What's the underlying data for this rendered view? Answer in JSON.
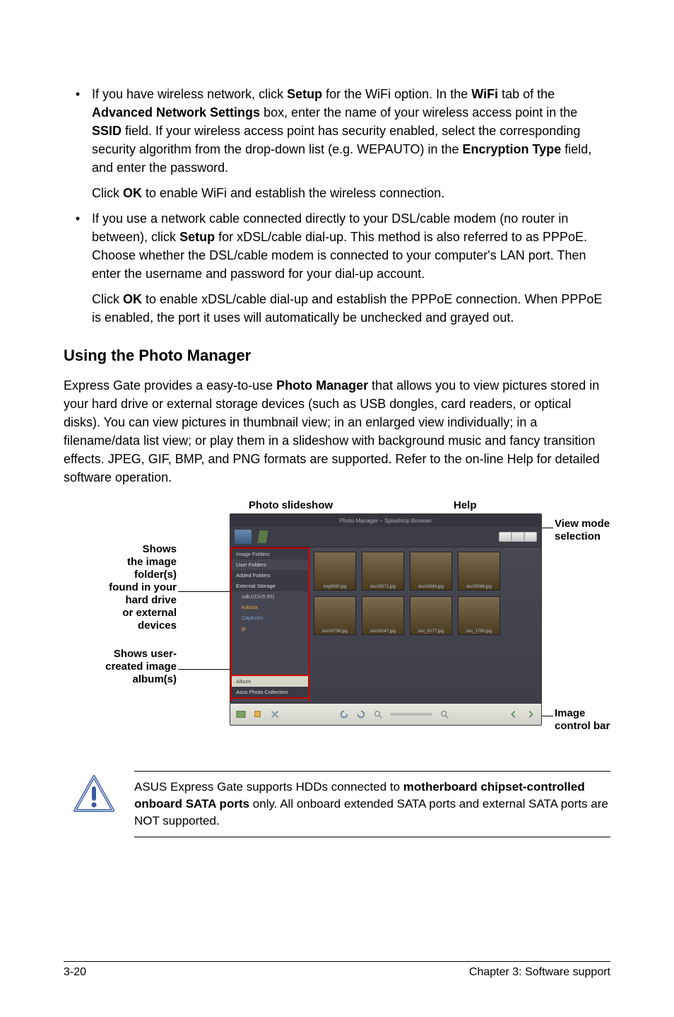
{
  "bullet1": {
    "text_a": "If you have wireless network, click ",
    "setup": "Setup",
    "text_b": " for the WiFi option. In the ",
    "wifi": "WiFi",
    "text_c": " tab of the ",
    "ans": "Advanced Network Settings",
    "text_d": " box, enter the name of your wireless access point in the ",
    "ssid": "SSID",
    "text_e": " field. If your wireless access point has security enabled, select the corresponding security algorithm from the drop-down list (e.g. WEPAUTO) in the ",
    "enc": "Encryption Type",
    "text_f": " field, and enter the password.",
    "sub_a": "Click ",
    "ok": "OK",
    "sub_b": " to enable WiFi and establish the wireless connection."
  },
  "bullet2": {
    "text_a": "If you use a network cable connected directly to your DSL/cable modem (no router in between), click ",
    "setup": "Setup",
    "text_b": " for xDSL/cable dial-up. This method is also referred to as PPPoE. Choose whether the DSL/cable modem is connected to your computer's LAN port. Then enter the username and password for your dial-up account.",
    "sub_a": "Click ",
    "ok": "OK",
    "sub_b": " to enable xDSL/cable dial-up and establish the PPPoE connection. When PPPoE is enabled, the port it uses will automatically be unchecked and grayed out."
  },
  "heading": "Using the Photo Manager",
  "para": {
    "a": "Express Gate  provides a easy-to-use ",
    "pm": "Photo Manager",
    "b": " that allows you to view pictures stored in your hard drive or external storage devices (such as USB dongles, card readers, or optical disks). You can view pictures in thumbnail view; in an enlarged view individually; in a filename/data list view; or play them in a slideshow with background music and fancy transition effects. JPEG, GIF, BMP, and PNG formats are supported. Refer to the on-line Help for detailed software operation."
  },
  "callouts": {
    "slideshow": "Photo slideshow",
    "help": "Help",
    "viewmode_l1": "View mode",
    "viewmode_l2": "selection",
    "left1_l1": "Shows",
    "left1_l2": "the image",
    "left1_l3": "folder(s)",
    "left1_l4": "found in your",
    "left1_l5": "hard drive",
    "left1_l6": "or external",
    "left1_l7": "devices",
    "left2_l1": "Shows user-",
    "left2_l2": "created image",
    "left2_l3": "album(s)",
    "img_l1": "Image",
    "img_l2": "control bar"
  },
  "app": {
    "title": "Photo Manager – Splashtop Browser",
    "pane": {
      "h1": "Image Folders",
      "h2": "User Folders",
      "add": "Added Folders",
      "ext": "External Storage",
      "dev": "sdb1(DV9.95)",
      "k": "kubota",
      "cap": "Captures",
      "jp": "jp",
      "album_hdr": "Album",
      "album_item": "Asus Photo Collection"
    },
    "thumbs": [
      "img6590.jpg",
      "dsc00371.jpg",
      "dsc04584.jpg",
      "dsc00066.jpg",
      "dsc00736.jpg",
      "dsc00147.jpg",
      "dsc_0177.jpg",
      "dsc_1790.jpg"
    ]
  },
  "note": {
    "a": "ASUS Express Gate supports HDDs connected to ",
    "b": "motherboard chipset-controlled onboard SATA ports",
    "c": " only. All onboard extended SATA ports and external SATA ports are NOT supported."
  },
  "footer": {
    "left": "3-20",
    "right": "Chapter 3: Software support"
  }
}
